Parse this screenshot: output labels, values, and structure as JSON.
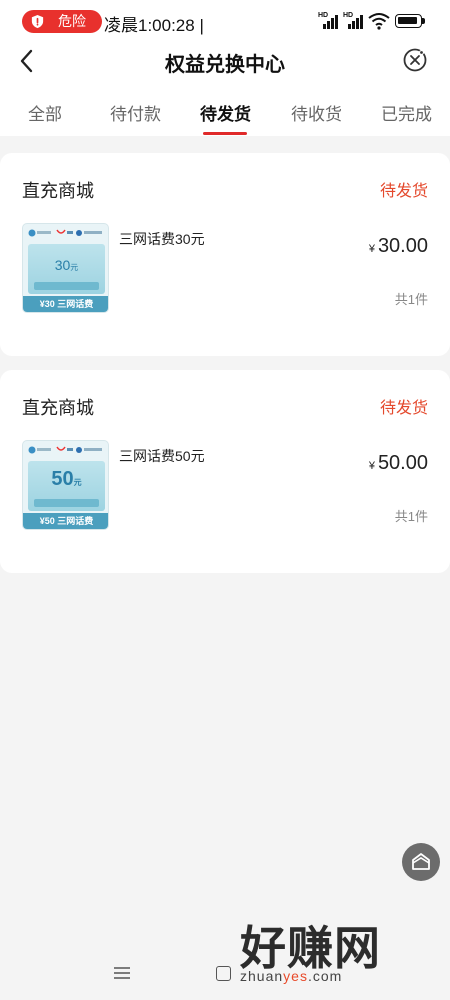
{
  "status_bar": {
    "danger_label": "危险",
    "time": "凌晨1:00:28 |",
    "hd_label": "HD"
  },
  "header": {
    "title": "权益兑换中心",
    "back_icon": "chevron-left-icon",
    "close_icon": "close-circle-icon"
  },
  "tabs": [
    {
      "label": "全部",
      "active": false
    },
    {
      "label": "待付款",
      "active": false
    },
    {
      "label": "待发货",
      "active": true
    },
    {
      "label": "待收货",
      "active": false
    },
    {
      "label": "已完成",
      "active": false
    }
  ],
  "orders": [
    {
      "store": "直充商城",
      "status": "待发货",
      "product": "三网话费30元",
      "currency": "¥",
      "price": "30.00",
      "quantity": "共1件",
      "thumb_amount": "30",
      "thumb_unit": "元",
      "thumb_footer": "¥30 三网话费"
    },
    {
      "store": "直充商城",
      "status": "待发货",
      "product": "三网话费50元",
      "currency": "¥",
      "price": "50.00",
      "quantity": "共1件",
      "thumb_amount": "50",
      "thumb_unit": "元",
      "thumb_footer": "¥50 三网话费"
    }
  ],
  "watermark": {
    "text": "好赚网",
    "url_part1": "zhuan",
    "url_accent": "yes",
    "url_part2": ".com"
  },
  "colors": {
    "accent_red": "#e02a2a",
    "status_orange": "#e4492d",
    "danger_pill": "#e8312d"
  }
}
